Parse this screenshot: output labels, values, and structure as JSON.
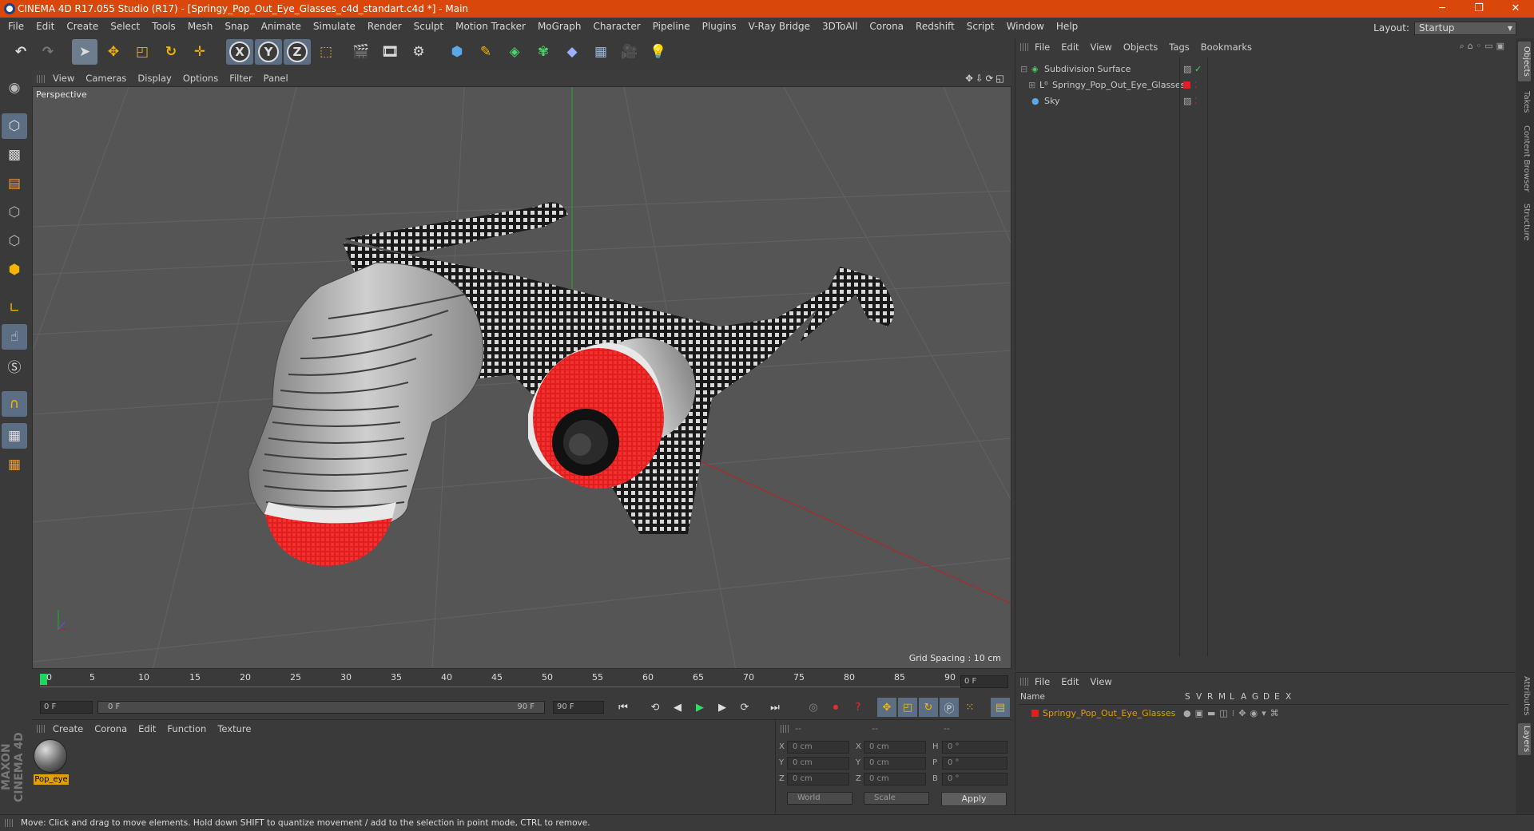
{
  "window": {
    "title": "CINEMA 4D R17.055 Studio (R17) - [Springy_Pop_Out_Eye_Glasses_c4d_standart.c4d *] - Main",
    "controls": [
      "─",
      "❐",
      "✕"
    ]
  },
  "menubar": {
    "items": [
      "File",
      "Edit",
      "Create",
      "Select",
      "Tools",
      "Mesh",
      "Snap",
      "Animate",
      "Simulate",
      "Render",
      "Sculpt",
      "Motion Tracker",
      "MoGraph",
      "Character",
      "Pipeline",
      "Plugins",
      "V-Ray Bridge",
      "3DToAll",
      "Corona",
      "Redshift",
      "Script",
      "Window",
      "Help"
    ],
    "layout_label": "Layout:",
    "layout_value": "Startup"
  },
  "toolbar": {
    "axis_labels": [
      "X",
      "Y",
      "Z"
    ]
  },
  "viewport": {
    "menu": [
      "View",
      "Cameras",
      "Display",
      "Options",
      "Filter",
      "Panel"
    ],
    "label": "Perspective",
    "grid_spacing": "Grid Spacing : 10 cm"
  },
  "timeline": {
    "ticks": [
      "0",
      "5",
      "10",
      "15",
      "20",
      "25",
      "30",
      "35",
      "40",
      "45",
      "50",
      "55",
      "60",
      "65",
      "70",
      "75",
      "80",
      "85",
      "90"
    ],
    "current_frame": "0 F",
    "start_field": "0 F",
    "range_start": "0 F",
    "range_end": "90 F",
    "end_field": "90 F"
  },
  "material_panel": {
    "menu": [
      "Create",
      "Corona",
      "Edit",
      "Function",
      "Texture"
    ],
    "materials": [
      {
        "name": "Pop_eye"
      }
    ]
  },
  "coords": {
    "headers": [
      "--",
      "--",
      "--"
    ],
    "rows": [
      {
        "a": "X",
        "av": "0 cm",
        "b": "X",
        "bv": "0 cm",
        "c": "H",
        "cv": "0 °"
      },
      {
        "a": "Y",
        "av": "0 cm",
        "b": "Y",
        "bv": "0 cm",
        "c": "P",
        "cv": "0 °"
      },
      {
        "a": "Z",
        "av": "0 cm",
        "b": "Z",
        "bv": "0 cm",
        "c": "B",
        "cv": "0 °"
      }
    ],
    "mode1": "World",
    "mode2": "Scale",
    "apply": "Apply"
  },
  "object_manager": {
    "menu": [
      "File",
      "Edit",
      "View",
      "Objects",
      "Tags",
      "Bookmarks"
    ],
    "objects": [
      {
        "name": "Subdivision Surface",
        "color": "#c8c8c8"
      },
      {
        "name": "Springy_Pop_Out_Eye_Glasses",
        "color": "#c8c8c8"
      },
      {
        "name": "Sky",
        "color": "#c8c8c8"
      }
    ]
  },
  "layer_manager": {
    "menu": [
      "File",
      "Edit",
      "View"
    ],
    "columns": [
      "Name",
      "S",
      "V",
      "R",
      "M",
      "L",
      "A",
      "G",
      "D",
      "E",
      "X"
    ],
    "layers": [
      {
        "name": "Springy_Pop_Out_Eye_Glasses",
        "color": "#e0a000"
      }
    ]
  },
  "right_tabs": [
    "Objects",
    "Takes",
    "Content Browser",
    "Structure",
    "Attributes",
    "Layers"
  ],
  "branding": "MAXON CINEMA 4D",
  "status": "Move: Click and drag to move elements. Hold down SHIFT to quantize movement / add to the selection in point mode, CTRL to remove.",
  "colors": {
    "titlebar": "#d9470b",
    "accent_orange": "#e0a000",
    "selection": "#6e7d8e"
  }
}
